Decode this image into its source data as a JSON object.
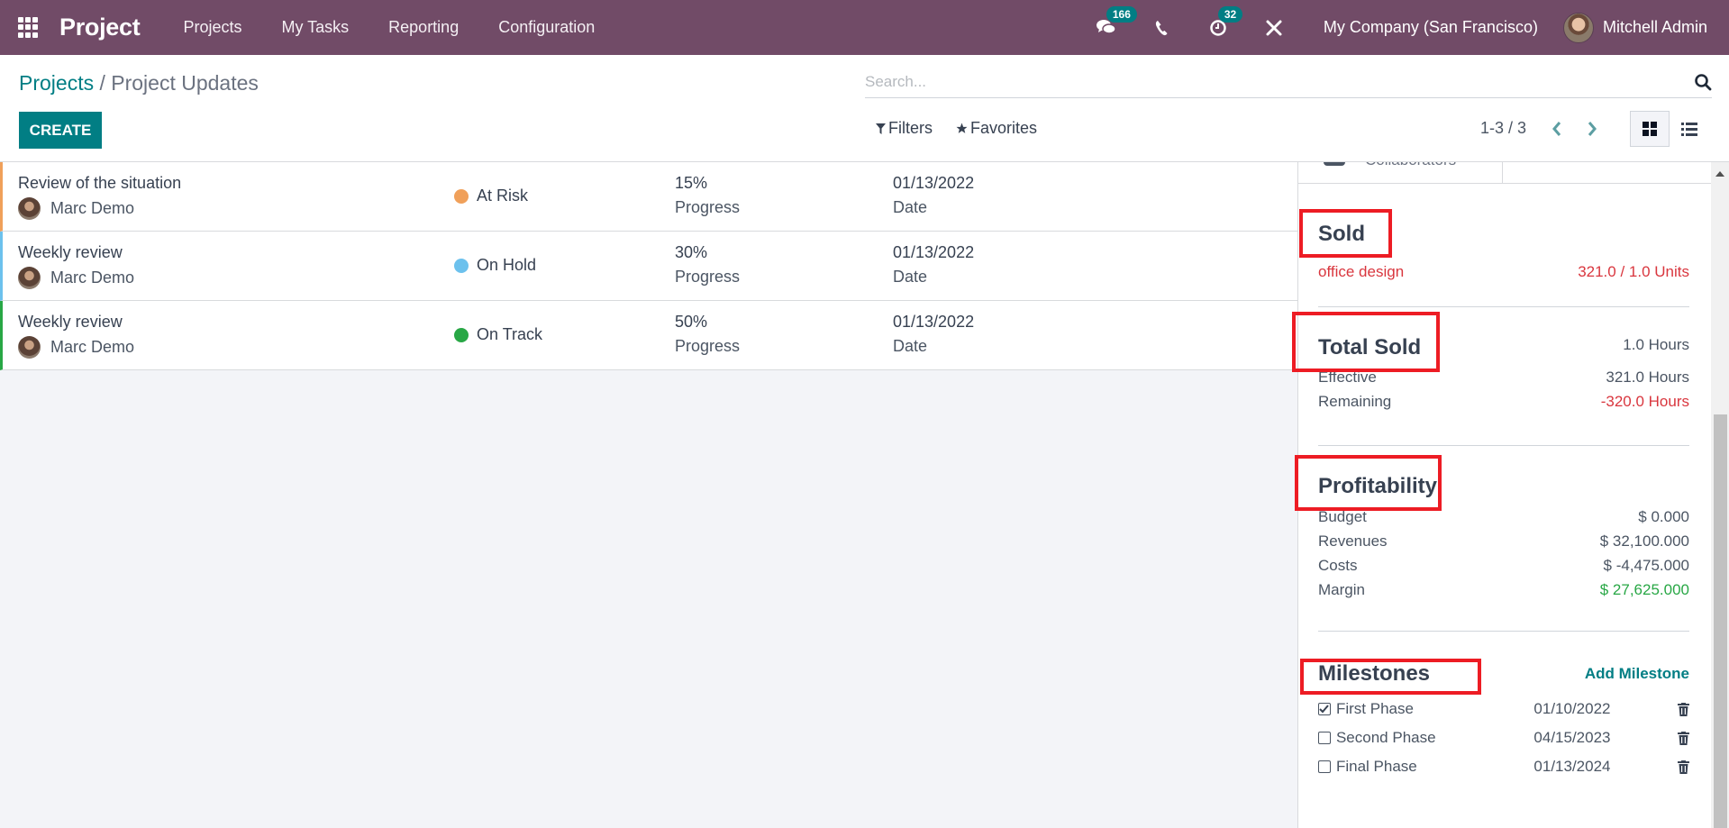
{
  "navbar": {
    "app_name": "Project",
    "menu": [
      "Projects",
      "My Tasks",
      "Reporting",
      "Configuration"
    ],
    "messages_count": "166",
    "activities_count": "32",
    "company": "My Company (San Francisco)",
    "user": "Mitchell Admin",
    "icons": [
      "apps-grid-icon",
      "chat-icon",
      "phone-icon",
      "clock-icon",
      "tools-icon"
    ]
  },
  "control": {
    "breadcrumb_parent": "Projects",
    "breadcrumb_separator": " / ",
    "breadcrumb_current": "Project Updates",
    "create_label": "CREATE",
    "search_placeholder": "Search...",
    "filters_label": "Filters",
    "favorites_label": "Favorites",
    "pager": "1-3 / 3",
    "views": [
      "kanban",
      "list"
    ],
    "active_view": "kanban"
  },
  "updates": [
    {
      "title": "Review of the situation",
      "user": "Marc Demo",
      "status": "At Risk",
      "status_color": "#f0a05a",
      "progress": "15%",
      "progress_label": "Progress",
      "date": "01/13/2022",
      "date_label": "Date"
    },
    {
      "title": "Weekly review",
      "user": "Marc Demo",
      "status": "On Hold",
      "status_color": "#6cc1ed",
      "progress": "30%",
      "progress_label": "Progress",
      "date": "01/13/2022",
      "date_label": "Date"
    },
    {
      "title": "Weekly review",
      "user": "Marc Demo",
      "status": "On Track",
      "status_color": "#28a745",
      "progress": "50%",
      "progress_label": "Progress",
      "date": "01/13/2022",
      "date_label": "Date"
    }
  ],
  "side": {
    "collaborators_label": "Collaborators",
    "sold": {
      "title": "Sold",
      "product": "office design",
      "value": "321.0 / 1.0 Units"
    },
    "total_sold": {
      "title": "Total Sold",
      "value": "1.0 Hours",
      "effective_label": "Effective",
      "effective_value": "321.0 Hours",
      "remaining_label": "Remaining",
      "remaining_value": "-320.0 Hours"
    },
    "profitability": {
      "title": "Profitability",
      "rows": [
        {
          "label": "Budget",
          "value": "$ 0.000"
        },
        {
          "label": "Revenues",
          "value": "$ 32,100.000"
        },
        {
          "label": "Costs",
          "value": "$ -4,475.000"
        },
        {
          "label": "Margin",
          "value": "$ 27,625.000"
        }
      ]
    },
    "milestones": {
      "title": "Milestones",
      "add_label": "Add Milestone",
      "items": [
        {
          "name": "First Phase",
          "date": "01/10/2022",
          "done": true
        },
        {
          "name": "Second Phase",
          "date": "04/15/2023",
          "done": false
        },
        {
          "name": "Final Phase",
          "date": "01/13/2024",
          "done": false
        }
      ]
    }
  },
  "colors": {
    "brand": "#714b67",
    "accent": "#017e84",
    "danger": "#d9363e",
    "success": "#28a745",
    "annotation": "#ed1c24"
  }
}
